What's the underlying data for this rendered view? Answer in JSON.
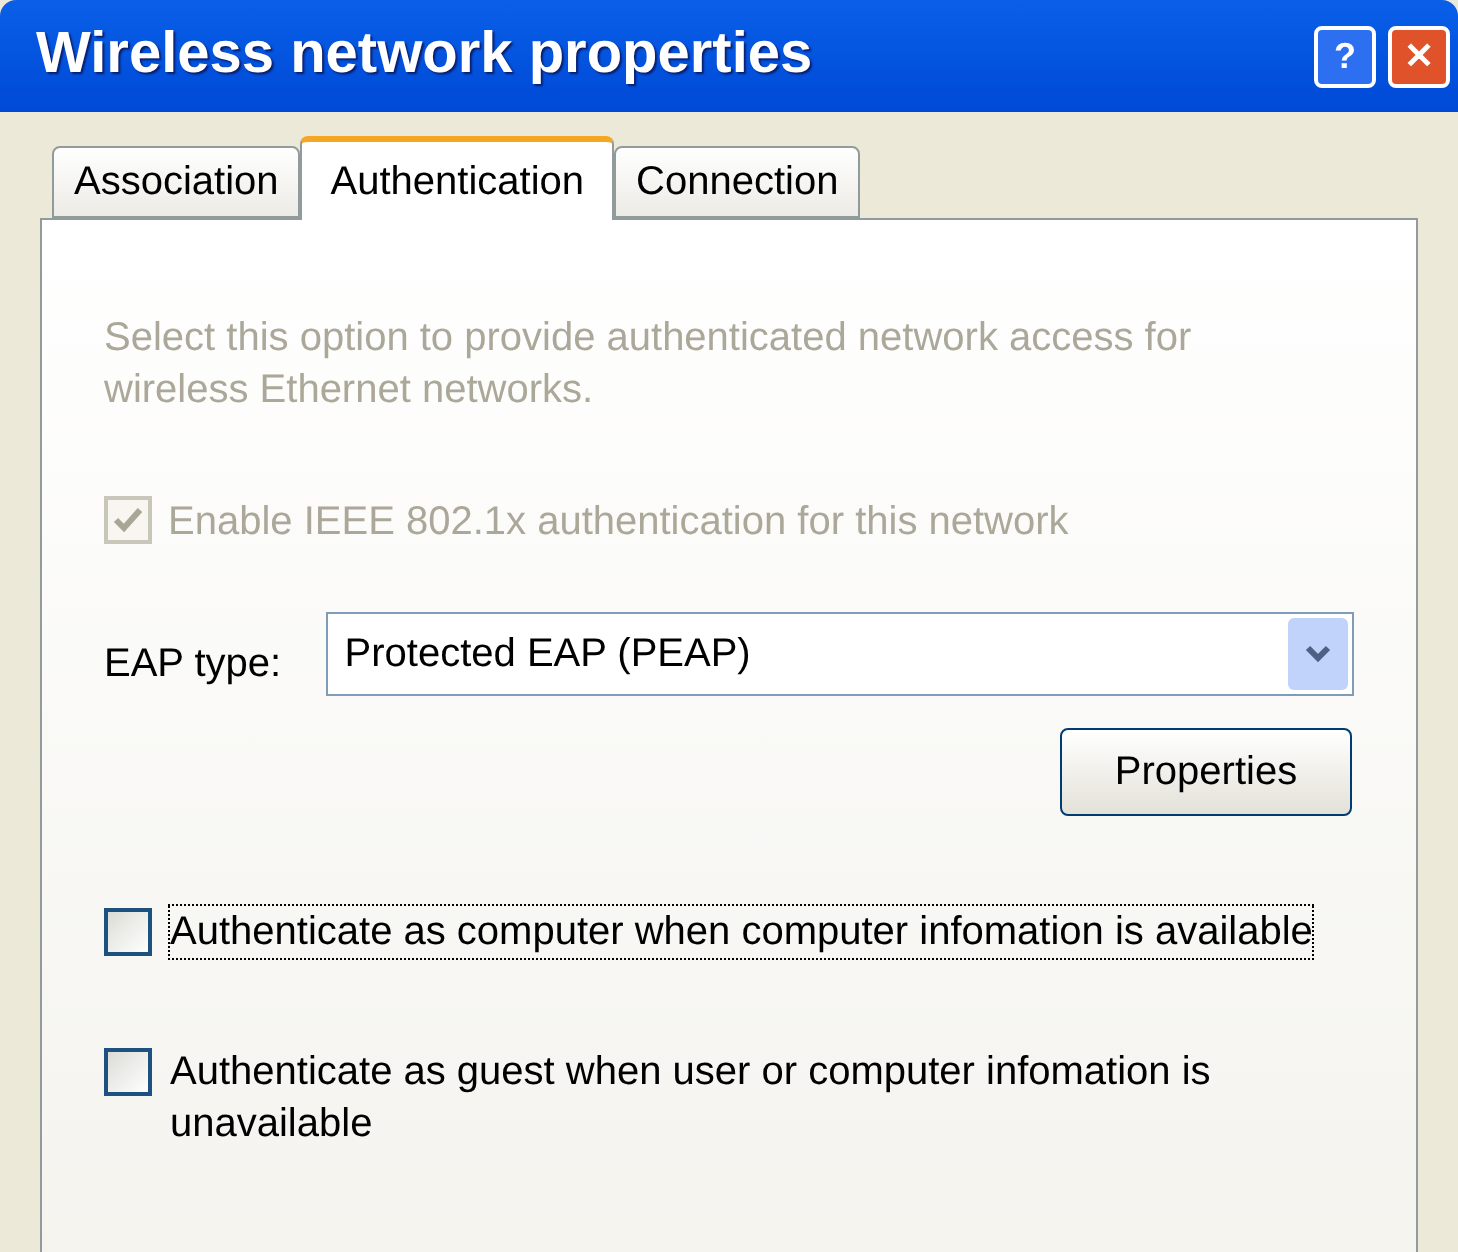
{
  "window": {
    "title": "Wireless network properties",
    "buttons": [
      {
        "kind": "help",
        "label": "?"
      },
      {
        "kind": "close",
        "label": "✕"
      }
    ]
  },
  "tabs": [
    {
      "label": "Association",
      "selected": false
    },
    {
      "label": "Authentication",
      "selected": true
    },
    {
      "label": "Connection",
      "selected": false
    }
  ],
  "description": {
    "text": "Select this option to provide authenticated network access for wireless Ethernet networks.",
    "disabled": true
  },
  "enable_checkbox": {
    "label": "Enable IEEE 802.1x authentication for this network",
    "checked": true,
    "disabled": true
  },
  "eap_type": {
    "label": "EAP type:",
    "value": "Protected EAP (PEAP)"
  },
  "properties_button": {
    "label": "Properties"
  },
  "options": [
    {
      "label": "Authenticate as computer when computer infomation is available",
      "checked": false,
      "focused": true
    },
    {
      "label": "Authenticate as guest when user or computer infomation is unavailable",
      "checked": false,
      "focused": false
    }
  ]
}
